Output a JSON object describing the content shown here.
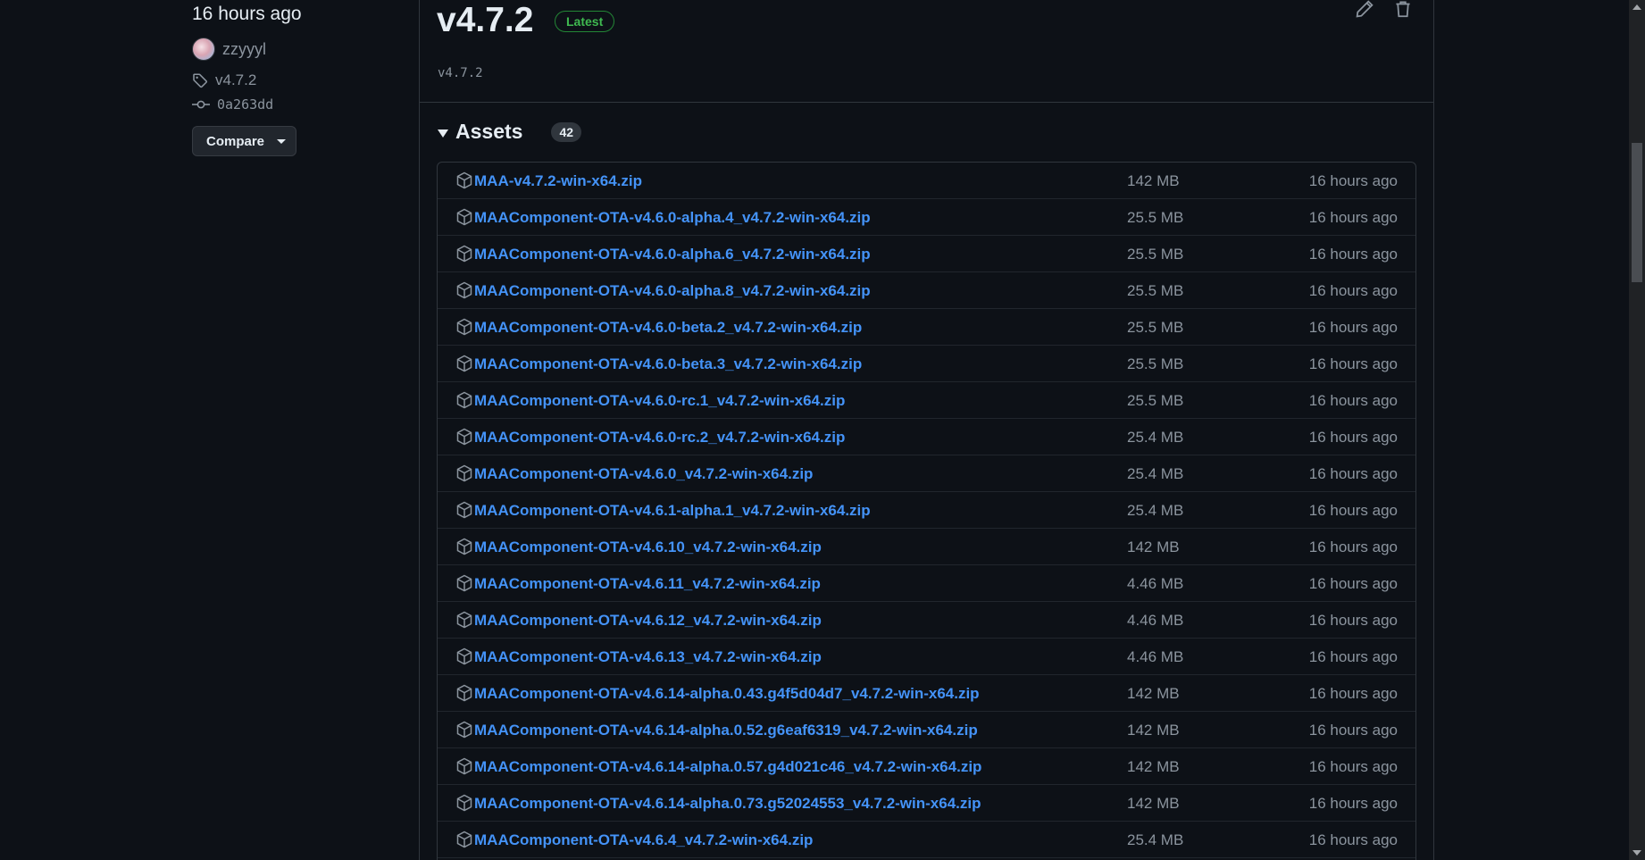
{
  "sidebar": {
    "time": "16 hours ago",
    "author": "zzyyyl",
    "tag": "v4.7.2",
    "commit": "0a263dd",
    "compare_label": "Compare"
  },
  "release": {
    "version": "v4.7.2",
    "badge": "Latest",
    "tagline": "v4.7.2"
  },
  "assets": {
    "title": "Assets",
    "count": "42",
    "items": [
      {
        "name": "MAA-v4.7.2-win-x64.zip",
        "size": "142 MB",
        "date": "16 hours ago"
      },
      {
        "name": "MAAComponent-OTA-v4.6.0-alpha.4_v4.7.2-win-x64.zip",
        "size": "25.5 MB",
        "date": "16 hours ago"
      },
      {
        "name": "MAAComponent-OTA-v4.6.0-alpha.6_v4.7.2-win-x64.zip",
        "size": "25.5 MB",
        "date": "16 hours ago"
      },
      {
        "name": "MAAComponent-OTA-v4.6.0-alpha.8_v4.7.2-win-x64.zip",
        "size": "25.5 MB",
        "date": "16 hours ago"
      },
      {
        "name": "MAAComponent-OTA-v4.6.0-beta.2_v4.7.2-win-x64.zip",
        "size": "25.5 MB",
        "date": "16 hours ago"
      },
      {
        "name": "MAAComponent-OTA-v4.6.0-beta.3_v4.7.2-win-x64.zip",
        "size": "25.5 MB",
        "date": "16 hours ago"
      },
      {
        "name": "MAAComponent-OTA-v4.6.0-rc.1_v4.7.2-win-x64.zip",
        "size": "25.5 MB",
        "date": "16 hours ago"
      },
      {
        "name": "MAAComponent-OTA-v4.6.0-rc.2_v4.7.2-win-x64.zip",
        "size": "25.4 MB",
        "date": "16 hours ago"
      },
      {
        "name": "MAAComponent-OTA-v4.6.0_v4.7.2-win-x64.zip",
        "size": "25.4 MB",
        "date": "16 hours ago"
      },
      {
        "name": "MAAComponent-OTA-v4.6.1-alpha.1_v4.7.2-win-x64.zip",
        "size": "25.4 MB",
        "date": "16 hours ago"
      },
      {
        "name": "MAAComponent-OTA-v4.6.10_v4.7.2-win-x64.zip",
        "size": "142 MB",
        "date": "16 hours ago"
      },
      {
        "name": "MAAComponent-OTA-v4.6.11_v4.7.2-win-x64.zip",
        "size": "4.46 MB",
        "date": "16 hours ago"
      },
      {
        "name": "MAAComponent-OTA-v4.6.12_v4.7.2-win-x64.zip",
        "size": "4.46 MB",
        "date": "16 hours ago"
      },
      {
        "name": "MAAComponent-OTA-v4.6.13_v4.7.2-win-x64.zip",
        "size": "4.46 MB",
        "date": "16 hours ago"
      },
      {
        "name": "MAAComponent-OTA-v4.6.14-alpha.0.43.g4f5d04d7_v4.7.2-win-x64.zip",
        "size": "142 MB",
        "date": "16 hours ago"
      },
      {
        "name": "MAAComponent-OTA-v4.6.14-alpha.0.52.g6eaf6319_v4.7.2-win-x64.zip",
        "size": "142 MB",
        "date": "16 hours ago"
      },
      {
        "name": "MAAComponent-OTA-v4.6.14-alpha.0.57.g4d021c46_v4.7.2-win-x64.zip",
        "size": "142 MB",
        "date": "16 hours ago"
      },
      {
        "name": "MAAComponent-OTA-v4.6.14-alpha.0.73.g52024553_v4.7.2-win-x64.zip",
        "size": "142 MB",
        "date": "16 hours ago"
      },
      {
        "name": "MAAComponent-OTA-v4.6.4_v4.7.2-win-x64.zip",
        "size": "25.4 MB",
        "date": "16 hours ago"
      }
    ]
  },
  "icons": {
    "tag": "tag-icon",
    "commit": "git-commit-icon",
    "package": "package-icon",
    "edit": "pencil-icon",
    "delete": "trash-icon"
  }
}
